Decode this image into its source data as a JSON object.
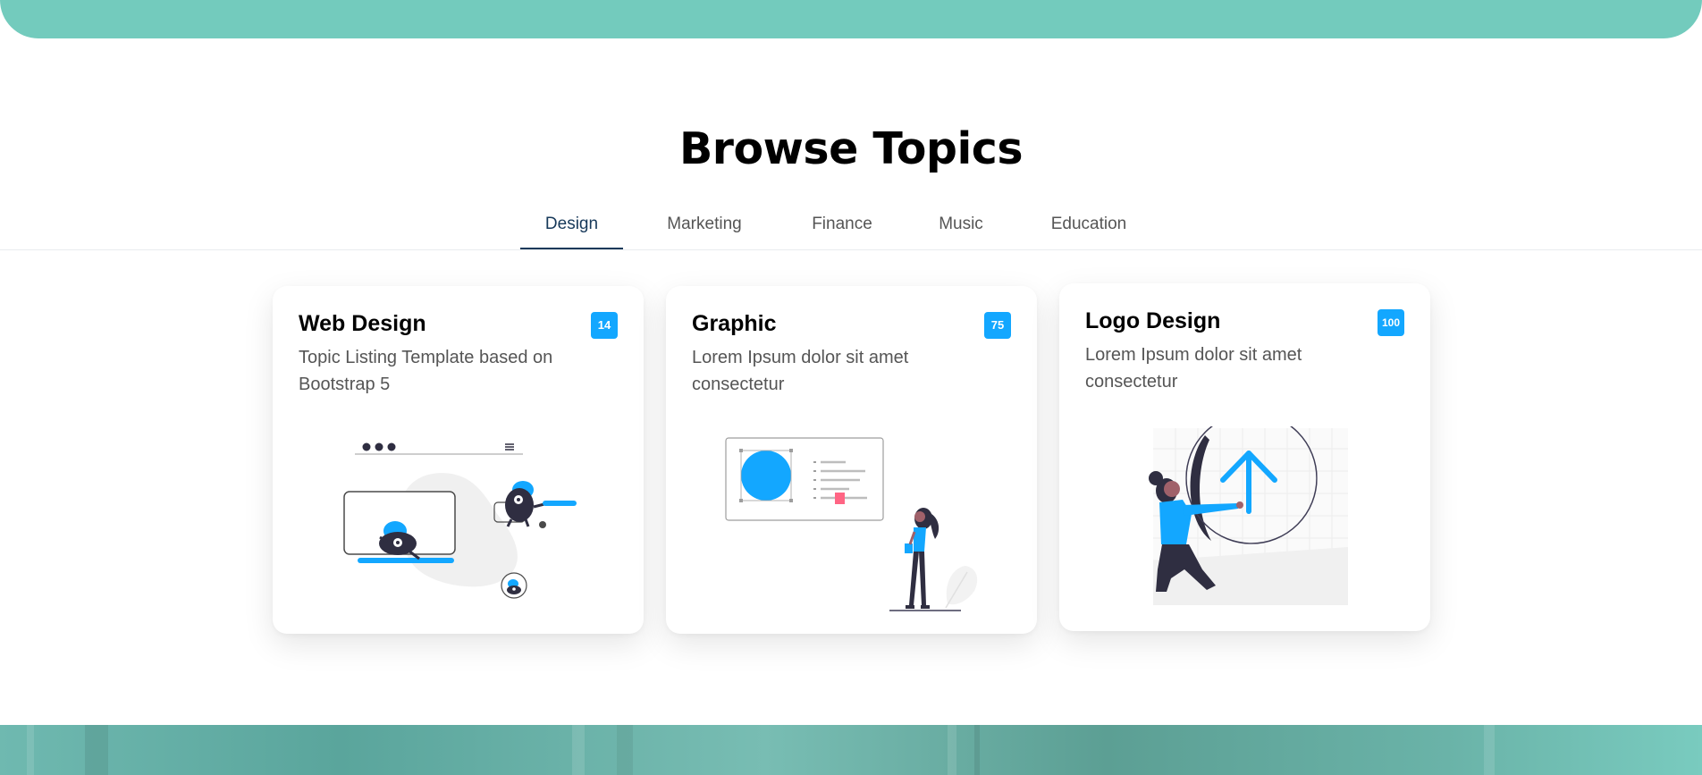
{
  "section": {
    "title": "Browse Topics"
  },
  "tabs": [
    {
      "label": "Design",
      "active": true
    },
    {
      "label": "Marketing",
      "active": false
    },
    {
      "label": "Finance",
      "active": false
    },
    {
      "label": "Music",
      "active": false
    },
    {
      "label": "Education",
      "active": false
    }
  ],
  "cards": [
    {
      "title": "Web Design",
      "badge": "14",
      "description": "Topic Listing Template based on Bootstrap 5",
      "illustration": "web-design-illustration"
    },
    {
      "title": "Graphic",
      "badge": "75",
      "description": "Lorem Ipsum dolor sit amet consectetur",
      "illustration": "graphic-illustration"
    },
    {
      "title": "Logo Design",
      "badge": "100",
      "description": "Lorem Ipsum dolor sit amet consectetur",
      "illustration": "logo-design-illustration"
    }
  ],
  "colors": {
    "accent": "#13a7ff",
    "hero": "#73cbbd",
    "active_tab": "#17395a"
  }
}
